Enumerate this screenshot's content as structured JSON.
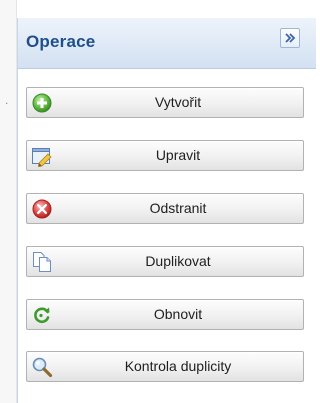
{
  "panel": {
    "title": "Operace",
    "collapse_icon": "double-chevron-right-icon",
    "left_edge_mark": "."
  },
  "actions": [
    {
      "label": "Vytvořit",
      "icon": "add-icon"
    },
    {
      "label": "Upravit",
      "icon": "edit-icon"
    },
    {
      "label": "Odstranit",
      "icon": "delete-icon"
    },
    {
      "label": "Duplikovat",
      "icon": "duplicate-icon"
    },
    {
      "label": "Obnovit",
      "icon": "restore-icon"
    },
    {
      "label": "Kontrola duplicity",
      "icon": "search-icon"
    }
  ],
  "colors": {
    "header_title": "#1f4f89",
    "header_bg": "#dfe9f6",
    "button_border": "#b2b2b2"
  }
}
